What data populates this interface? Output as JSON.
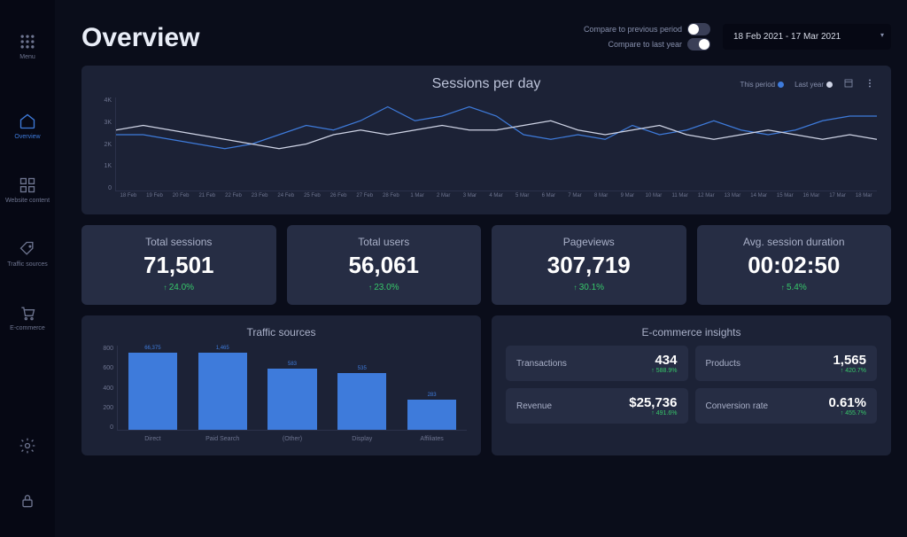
{
  "sidebar": {
    "menu": "Menu",
    "items": [
      {
        "label": "Overview"
      },
      {
        "label": "Website content"
      },
      {
        "label": "Traffic sources"
      },
      {
        "label": "E-commerce"
      }
    ]
  },
  "header": {
    "title": "Overview",
    "compare_prev": "Compare to previous period",
    "compare_last_year": "Compare to last year",
    "date_range": "18 Feb 2021 - 17 Mar 2021"
  },
  "sessions": {
    "title": "Sessions per day",
    "legend_this": "This period",
    "legend_last": "Last year",
    "colors": {
      "this": "#3e7bdb",
      "last": "#cfd4e6"
    }
  },
  "chart_data": [
    {
      "id": "sessions_per_day",
      "type": "line",
      "title": "Sessions per day",
      "xlabel": "",
      "ylabel": "",
      "ylim": [
        0,
        4000
      ],
      "y_ticks": [
        "4K",
        "3K",
        "2K",
        "1K",
        "0"
      ],
      "x": [
        "18 Feb",
        "19 Feb",
        "20 Feb",
        "21 Feb",
        "22 Feb",
        "23 Feb",
        "24 Feb",
        "25 Feb",
        "26 Feb",
        "27 Feb",
        "28 Feb",
        "1 Mar",
        "2 Mar",
        "3 Mar",
        "4 Mar",
        "5 Mar",
        "6 Mar",
        "7 Mar",
        "8 Mar",
        "9 Mar",
        "10 Mar",
        "11 Mar",
        "12 Mar",
        "13 Mar",
        "14 Mar",
        "15 Mar",
        "16 Mar",
        "17 Mar",
        "18 Mar"
      ],
      "series": [
        {
          "name": "This period",
          "color": "#3e7bdb",
          "values": [
            2400,
            2400,
            2200,
            2000,
            1800,
            2000,
            2400,
            2800,
            2600,
            3000,
            3600,
            3000,
            3200,
            3600,
            3200,
            2400,
            2200,
            2400,
            2200,
            2800,
            2400,
            2600,
            3000,
            2600,
            2400,
            2600,
            3000,
            3200,
            3200
          ]
        },
        {
          "name": "Last year",
          "color": "#cfd4e6",
          "values": [
            2600,
            2800,
            2600,
            2400,
            2200,
            2000,
            1800,
            2000,
            2400,
            2600,
            2400,
            2600,
            2800,
            2600,
            2600,
            2800,
            3000,
            2600,
            2400,
            2600,
            2800,
            2400,
            2200,
            2400,
            2600,
            2400,
            2200,
            2400,
            2200
          ]
        }
      ]
    },
    {
      "id": "traffic_sources",
      "type": "bar",
      "title": "Traffic sources",
      "xlabel": "",
      "ylabel": "",
      "ylim": [
        0,
        800
      ],
      "y_ticks": [
        "800",
        "600",
        "400",
        "200",
        "0"
      ],
      "categories": [
        "Direct",
        "Paid Search",
        "(Other)",
        "Display",
        "Affiliates"
      ],
      "values": [
        66375,
        1465,
        583,
        535,
        283
      ]
    }
  ],
  "kpis": [
    {
      "label": "Total sessions",
      "value": "71,501",
      "trend": "24.0%"
    },
    {
      "label": "Total users",
      "value": "56,061",
      "trend": "23.0%"
    },
    {
      "label": "Pageviews",
      "value": "307,719",
      "trend": "30.1%"
    },
    {
      "label": "Avg. session duration",
      "value": "00:02:50",
      "trend": "5.4%"
    }
  ],
  "traffic": {
    "title": "Traffic sources"
  },
  "ecom": {
    "title": "E-commerce insights",
    "items": [
      {
        "label": "Transactions",
        "value": "434",
        "trend": "588.9%"
      },
      {
        "label": "Products",
        "value": "1,565",
        "trend": "420.7%"
      },
      {
        "label": "Revenue",
        "value": "$25,736",
        "trend": "491.6%"
      },
      {
        "label": "Conversion rate",
        "value": "0.61%",
        "trend": "455.7%"
      }
    ]
  }
}
